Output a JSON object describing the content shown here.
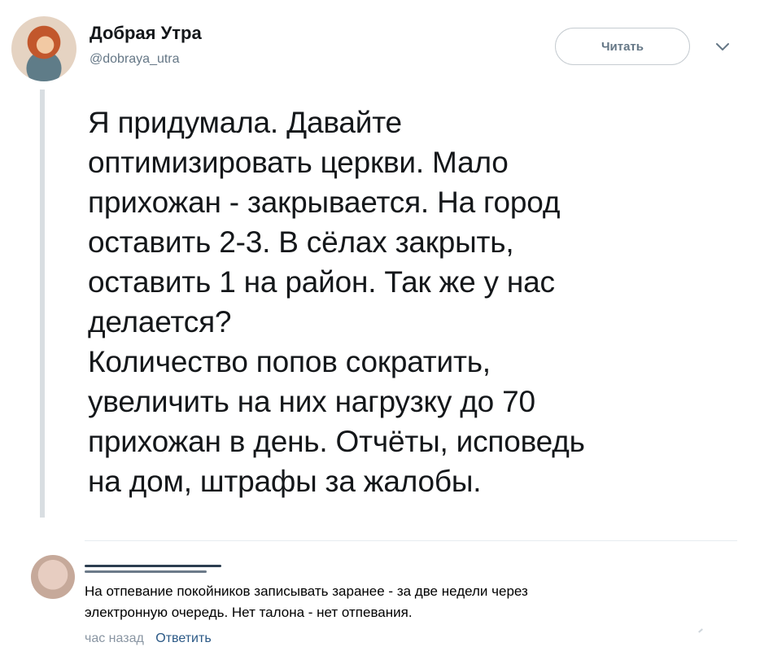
{
  "tweet": {
    "author_name": "Добрая Утра",
    "author_handle": "@dobraya_utra",
    "follow_label": "Читать",
    "lines": [
      "Я придумала. Давайте",
      "оптимизировать церкви. Мало",
      "прихожан - закрывается. На город",
      "оставить 2-3. В сёлах закрыть,",
      "оставить 1 на район. Так же у нас",
      "делается?",
      "Количество попов сократить,",
      "увеличить на них нагрузку до 70",
      "прихожан в день. Отчёты, исповедь",
      "на дом, штрафы за жалобы."
    ]
  },
  "comment": {
    "lines": [
      "На отпевание покойников записывать заранее - за две недели через",
      "электронную очередь. Нет талона - нет отпевания."
    ],
    "time": "час назад",
    "reply_label": "Ответить"
  },
  "icons": {
    "avatar": "avatar-image",
    "chevron": "chevron-down-icon"
  }
}
